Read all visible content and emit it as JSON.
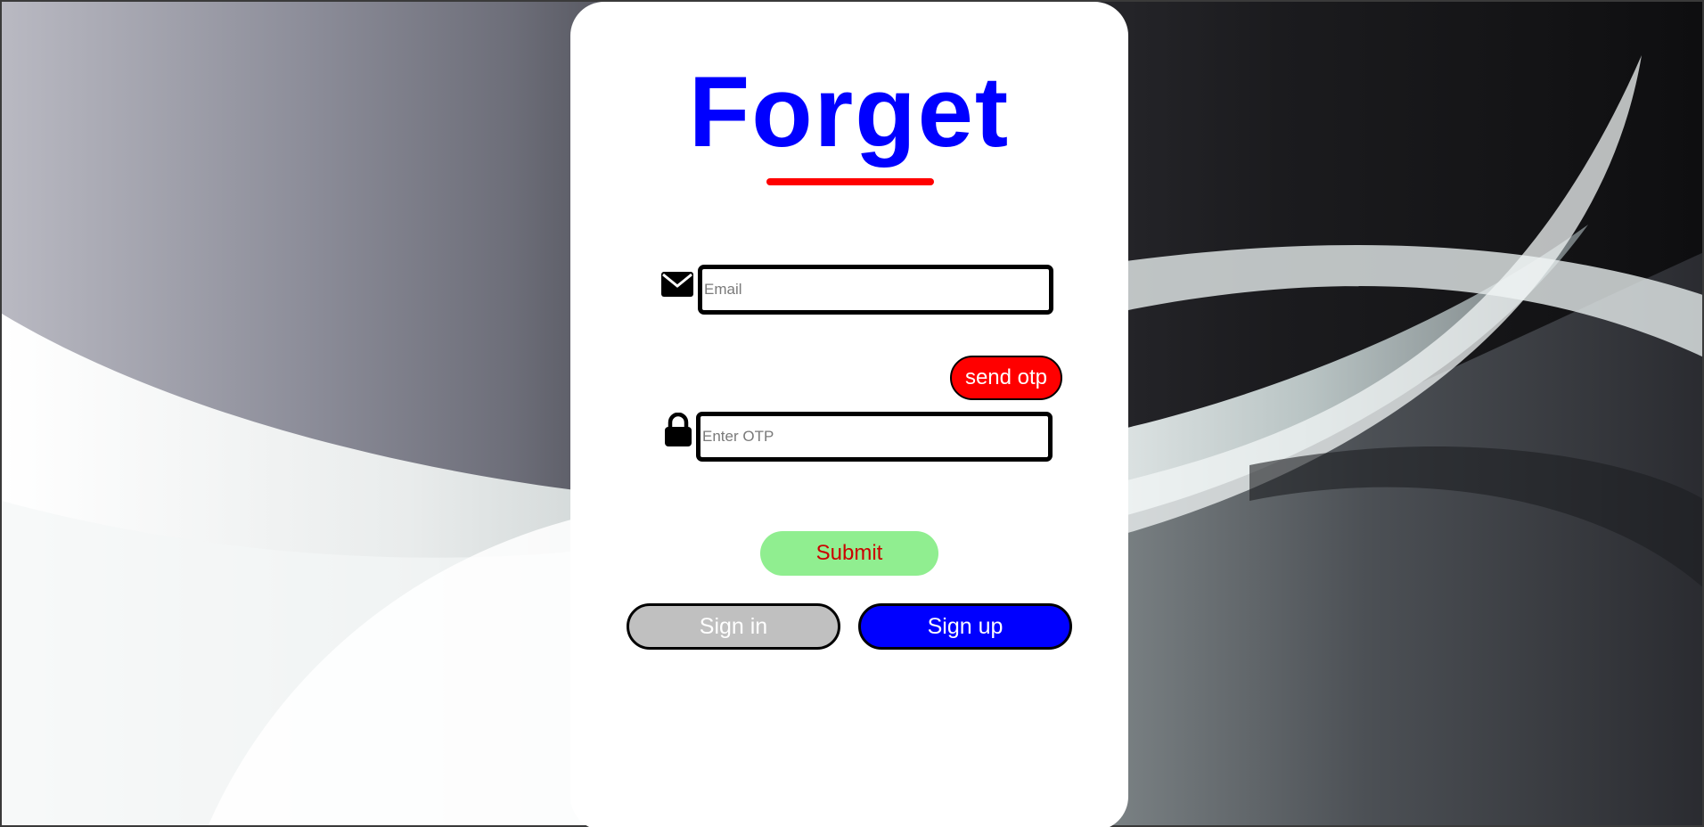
{
  "page": {
    "title": "Forget"
  },
  "form": {
    "email": {
      "placeholder": "Email",
      "value": "",
      "icon": "envelope-icon"
    },
    "send_otp_label": "send otp",
    "otp": {
      "placeholder": "Enter OTP",
      "value": "",
      "icon": "lock-icon"
    },
    "submit_label": "Submit"
  },
  "nav": {
    "signin_label": "Sign in",
    "signup_label": "Sign up"
  },
  "colors": {
    "title": "#0000ff",
    "underline": "#ff0000",
    "send_otp_bg": "#ff0000",
    "submit_bg": "#90ee90",
    "submit_text": "#cc0000",
    "signin_bg": "#c0c0c0",
    "signup_bg": "#0000ff",
    "card_bg": "#ffffff"
  }
}
